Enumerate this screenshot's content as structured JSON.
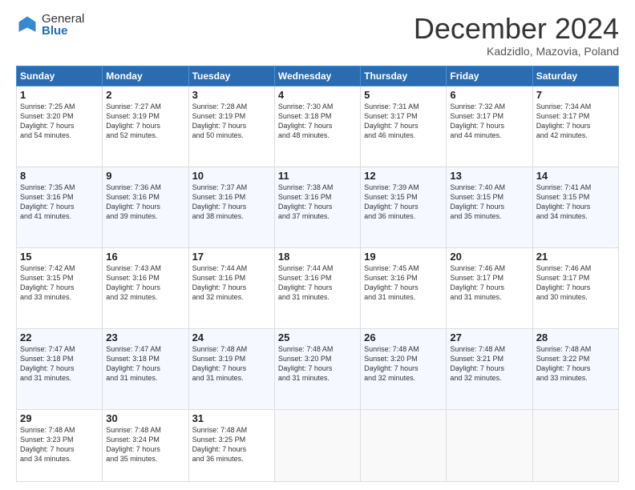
{
  "header": {
    "logo_general": "General",
    "logo_blue": "Blue",
    "month_title": "December 2024",
    "location": "Kadzidlo, Mazovia, Poland"
  },
  "weekdays": [
    "Sunday",
    "Monday",
    "Tuesday",
    "Wednesday",
    "Thursday",
    "Friday",
    "Saturday"
  ],
  "weeks": [
    [
      {
        "day": "1",
        "lines": [
          "Sunrise: 7:25 AM",
          "Sunset: 3:20 PM",
          "Daylight: 7 hours",
          "and 54 minutes."
        ]
      },
      {
        "day": "2",
        "lines": [
          "Sunrise: 7:27 AM",
          "Sunset: 3:19 PM",
          "Daylight: 7 hours",
          "and 52 minutes."
        ]
      },
      {
        "day": "3",
        "lines": [
          "Sunrise: 7:28 AM",
          "Sunset: 3:19 PM",
          "Daylight: 7 hours",
          "and 50 minutes."
        ]
      },
      {
        "day": "4",
        "lines": [
          "Sunrise: 7:30 AM",
          "Sunset: 3:18 PM",
          "Daylight: 7 hours",
          "and 48 minutes."
        ]
      },
      {
        "day": "5",
        "lines": [
          "Sunrise: 7:31 AM",
          "Sunset: 3:17 PM",
          "Daylight: 7 hours",
          "and 46 minutes."
        ]
      },
      {
        "day": "6",
        "lines": [
          "Sunrise: 7:32 AM",
          "Sunset: 3:17 PM",
          "Daylight: 7 hours",
          "and 44 minutes."
        ]
      },
      {
        "day": "7",
        "lines": [
          "Sunrise: 7:34 AM",
          "Sunset: 3:17 PM",
          "Daylight: 7 hours",
          "and 42 minutes."
        ]
      }
    ],
    [
      {
        "day": "8",
        "lines": [
          "Sunrise: 7:35 AM",
          "Sunset: 3:16 PM",
          "Daylight: 7 hours",
          "and 41 minutes."
        ]
      },
      {
        "day": "9",
        "lines": [
          "Sunrise: 7:36 AM",
          "Sunset: 3:16 PM",
          "Daylight: 7 hours",
          "and 39 minutes."
        ]
      },
      {
        "day": "10",
        "lines": [
          "Sunrise: 7:37 AM",
          "Sunset: 3:16 PM",
          "Daylight: 7 hours",
          "and 38 minutes."
        ]
      },
      {
        "day": "11",
        "lines": [
          "Sunrise: 7:38 AM",
          "Sunset: 3:16 PM",
          "Daylight: 7 hours",
          "and 37 minutes."
        ]
      },
      {
        "day": "12",
        "lines": [
          "Sunrise: 7:39 AM",
          "Sunset: 3:15 PM",
          "Daylight: 7 hours",
          "and 36 minutes."
        ]
      },
      {
        "day": "13",
        "lines": [
          "Sunrise: 7:40 AM",
          "Sunset: 3:15 PM",
          "Daylight: 7 hours",
          "and 35 minutes."
        ]
      },
      {
        "day": "14",
        "lines": [
          "Sunrise: 7:41 AM",
          "Sunset: 3:15 PM",
          "Daylight: 7 hours",
          "and 34 minutes."
        ]
      }
    ],
    [
      {
        "day": "15",
        "lines": [
          "Sunrise: 7:42 AM",
          "Sunset: 3:15 PM",
          "Daylight: 7 hours",
          "and 33 minutes."
        ]
      },
      {
        "day": "16",
        "lines": [
          "Sunrise: 7:43 AM",
          "Sunset: 3:16 PM",
          "Daylight: 7 hours",
          "and 32 minutes."
        ]
      },
      {
        "day": "17",
        "lines": [
          "Sunrise: 7:44 AM",
          "Sunset: 3:16 PM",
          "Daylight: 7 hours",
          "and 32 minutes."
        ]
      },
      {
        "day": "18",
        "lines": [
          "Sunrise: 7:44 AM",
          "Sunset: 3:16 PM",
          "Daylight: 7 hours",
          "and 31 minutes."
        ]
      },
      {
        "day": "19",
        "lines": [
          "Sunrise: 7:45 AM",
          "Sunset: 3:16 PM",
          "Daylight: 7 hours",
          "and 31 minutes."
        ]
      },
      {
        "day": "20",
        "lines": [
          "Sunrise: 7:46 AM",
          "Sunset: 3:17 PM",
          "Daylight: 7 hours",
          "and 31 minutes."
        ]
      },
      {
        "day": "21",
        "lines": [
          "Sunrise: 7:46 AM",
          "Sunset: 3:17 PM",
          "Daylight: 7 hours",
          "and 30 minutes."
        ]
      }
    ],
    [
      {
        "day": "22",
        "lines": [
          "Sunrise: 7:47 AM",
          "Sunset: 3:18 PM",
          "Daylight: 7 hours",
          "and 31 minutes."
        ]
      },
      {
        "day": "23",
        "lines": [
          "Sunrise: 7:47 AM",
          "Sunset: 3:18 PM",
          "Daylight: 7 hours",
          "and 31 minutes."
        ]
      },
      {
        "day": "24",
        "lines": [
          "Sunrise: 7:48 AM",
          "Sunset: 3:19 PM",
          "Daylight: 7 hours",
          "and 31 minutes."
        ]
      },
      {
        "day": "25",
        "lines": [
          "Sunrise: 7:48 AM",
          "Sunset: 3:20 PM",
          "Daylight: 7 hours",
          "and 31 minutes."
        ]
      },
      {
        "day": "26",
        "lines": [
          "Sunrise: 7:48 AM",
          "Sunset: 3:20 PM",
          "Daylight: 7 hours",
          "and 32 minutes."
        ]
      },
      {
        "day": "27",
        "lines": [
          "Sunrise: 7:48 AM",
          "Sunset: 3:21 PM",
          "Daylight: 7 hours",
          "and 32 minutes."
        ]
      },
      {
        "day": "28",
        "lines": [
          "Sunrise: 7:48 AM",
          "Sunset: 3:22 PM",
          "Daylight: 7 hours",
          "and 33 minutes."
        ]
      }
    ],
    [
      {
        "day": "29",
        "lines": [
          "Sunrise: 7:48 AM",
          "Sunset: 3:23 PM",
          "Daylight: 7 hours",
          "and 34 minutes."
        ]
      },
      {
        "day": "30",
        "lines": [
          "Sunrise: 7:48 AM",
          "Sunset: 3:24 PM",
          "Daylight: 7 hours",
          "and 35 minutes."
        ]
      },
      {
        "day": "31",
        "lines": [
          "Sunrise: 7:48 AM",
          "Sunset: 3:25 PM",
          "Daylight: 7 hours",
          "and 36 minutes."
        ]
      },
      {
        "day": "",
        "lines": []
      },
      {
        "day": "",
        "lines": []
      },
      {
        "day": "",
        "lines": []
      },
      {
        "day": "",
        "lines": []
      }
    ]
  ]
}
